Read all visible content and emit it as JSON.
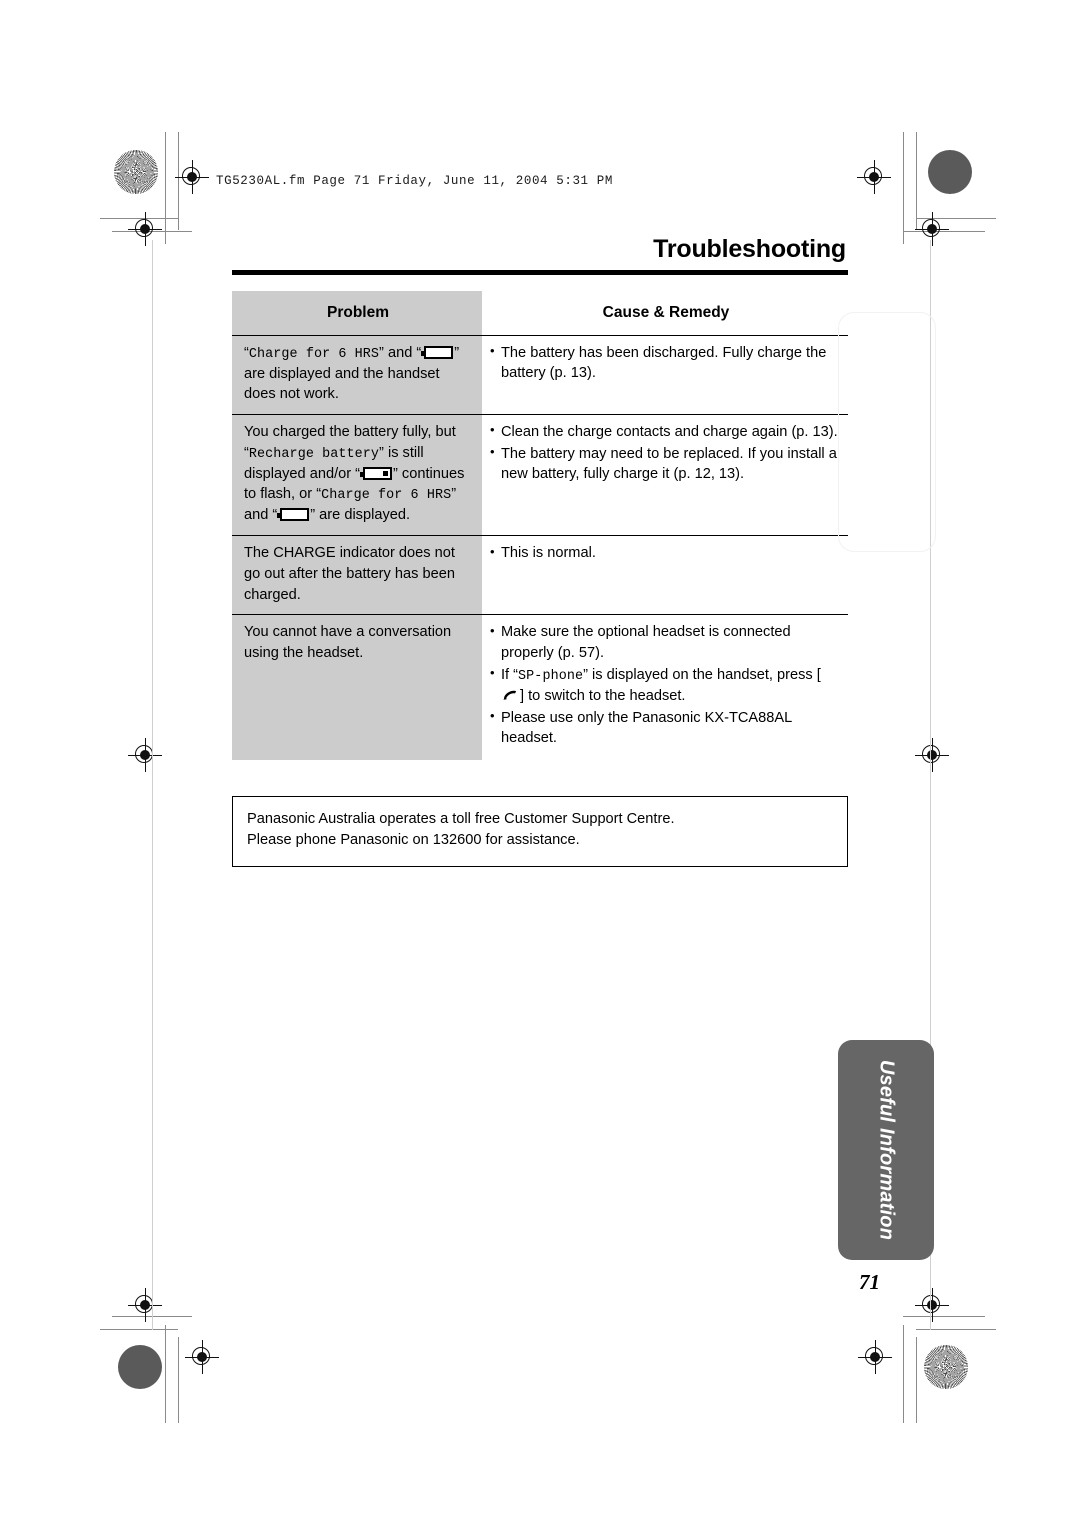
{
  "film_header": "TG5230AL.fm  Page 71  Friday, June 11, 2004  5:31 PM",
  "chapter_title": "Troubleshooting",
  "table": {
    "headers": {
      "problem": "Problem",
      "cause": "Cause & Remedy"
    },
    "rows": [
      {
        "problem_parts": {
          "q1_open": "“",
          "mono1": "Charge for 6 HRS",
          "q1_close": "” and",
          "q2_open": "“",
          "battery_icon": "battery-empty-icon",
          "q2_close": "” are displayed and the handset does not work."
        },
        "causes": [
          "The battery has been discharged. Fully charge the battery (p. 13)."
        ]
      },
      {
        "problem_parts": {
          "lead": "You charged the battery fully, but “",
          "mono1": "Recharge battery",
          "mid1": "” is still displayed and/or “",
          "battery_icon_1": "battery-low-icon",
          "mid2": "” continues to flash, or “",
          "mono2": "Charge for 6 HRS",
          "mid3": "” and “",
          "battery_icon_2": "battery-empty-icon",
          "tail": "” are displayed."
        },
        "causes": [
          "Clean the charge contacts and charge again (p. 13).",
          "The battery may need to be replaced. If you install a new battery, fully charge it (p. 12, 13)."
        ]
      },
      {
        "problem_text": "The CHARGE indicator does not go out after the battery has been charged.",
        "causes": [
          "This is normal."
        ]
      },
      {
        "problem_text": "You cannot have a conversation using the headset.",
        "cause_parts": {
          "b1": "Make sure the optional headset is connected properly (p. 57).",
          "b2_pre": "If “",
          "b2_mono": "SP-phone",
          "b2_mid": "” is displayed on the handset, press [",
          "b2_icon": "handset-talk-icon",
          "b2_post": "] to switch to the headset.",
          "b3": "Please use only the Panasonic KX-TCA88AL headset."
        }
      }
    ]
  },
  "note_box": {
    "line1": "Panasonic Australia operates a toll free Customer Support Centre.",
    "line2": "Please phone Panasonic on 132600 for assistance."
  },
  "side_tab": {
    "label": "Useful Information"
  },
  "page_number": "71",
  "colors": {
    "problem_column_fill": "#cccccc",
    "side_tab_fill": "#666666",
    "rule": "#000000"
  }
}
